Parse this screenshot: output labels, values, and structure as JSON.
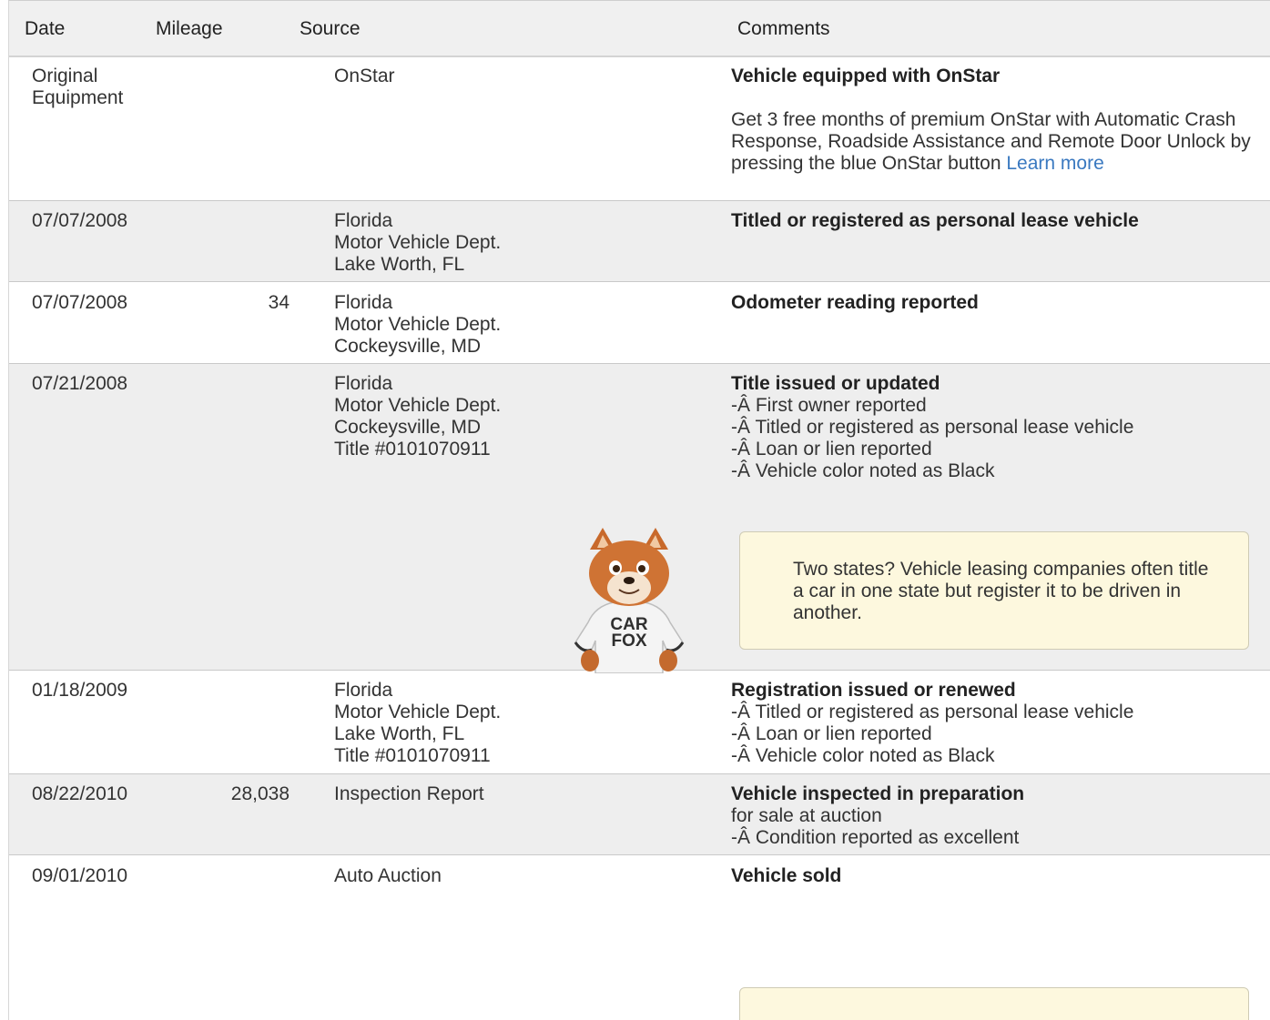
{
  "columns": {
    "date": "Date",
    "mileage": "Mileage",
    "source": "Source",
    "comments": "Comments"
  },
  "rows": [
    {
      "date": [
        "Original",
        "Equipment"
      ],
      "mileage": "",
      "source": [
        "OnStar"
      ],
      "comment_title": "Vehicle equipped with OnStar",
      "comment_lines": [],
      "comment_paragraph": "Get 3 free months of premium OnStar with Automatic Crash Response, Roadside Assistance and Remote Door Unlock by pressing the blue OnStar button",
      "comment_link": "Learn more"
    },
    {
      "date": [
        "07/07/2008"
      ],
      "mileage": "",
      "source": [
        "Florida",
        "Motor Vehicle Dept.",
        "Lake Worth, FL"
      ],
      "comment_title": "Titled or registered as personal lease vehicle",
      "comment_lines": []
    },
    {
      "date": [
        "07/07/2008"
      ],
      "mileage": "34",
      "source": [
        "Florida",
        "Motor Vehicle Dept.",
        "Cockeysville, MD"
      ],
      "comment_title": "Odometer reading reported",
      "comment_lines": []
    },
    {
      "date": [
        "07/21/2008"
      ],
      "mileage": "",
      "source": [
        "Florida",
        "Motor Vehicle Dept.",
        "Cockeysville, MD",
        "Title #0101070911"
      ],
      "comment_title": "Title issued or updated",
      "comment_lines": [
        "-Â First owner reported",
        "-Â Titled or registered as personal lease vehicle",
        "-Â Loan or lien reported",
        "-Â Vehicle color noted as Black"
      ],
      "tip": "Two states? Vehicle leasing companies often title a car in one state but register it to be driven in another.",
      "mascot_text": [
        "CAR",
        "FOX"
      ]
    },
    {
      "date": [
        "01/18/2009"
      ],
      "mileage": "",
      "source": [
        "Florida",
        "Motor Vehicle Dept.",
        "Lake Worth, FL",
        "Title #0101070911"
      ],
      "comment_title": "Registration issued or renewed",
      "comment_lines": [
        "-Â Titled or registered as personal lease vehicle",
        "-Â Loan or lien reported",
        "-Â Vehicle color noted as Black"
      ]
    },
    {
      "date": [
        "08/22/2010"
      ],
      "mileage": "28,038",
      "source": [
        "Inspection Report"
      ],
      "comment_title": "Vehicle inspected in preparation",
      "comment_lines": [
        "for sale at auction",
        "-Â Condition reported as excellent"
      ]
    },
    {
      "date": [
        "09/01/2010"
      ],
      "mileage": "",
      "source": [
        "Auto Auction"
      ],
      "comment_title": "Vehicle sold",
      "comment_lines": [],
      "tip": ""
    }
  ]
}
